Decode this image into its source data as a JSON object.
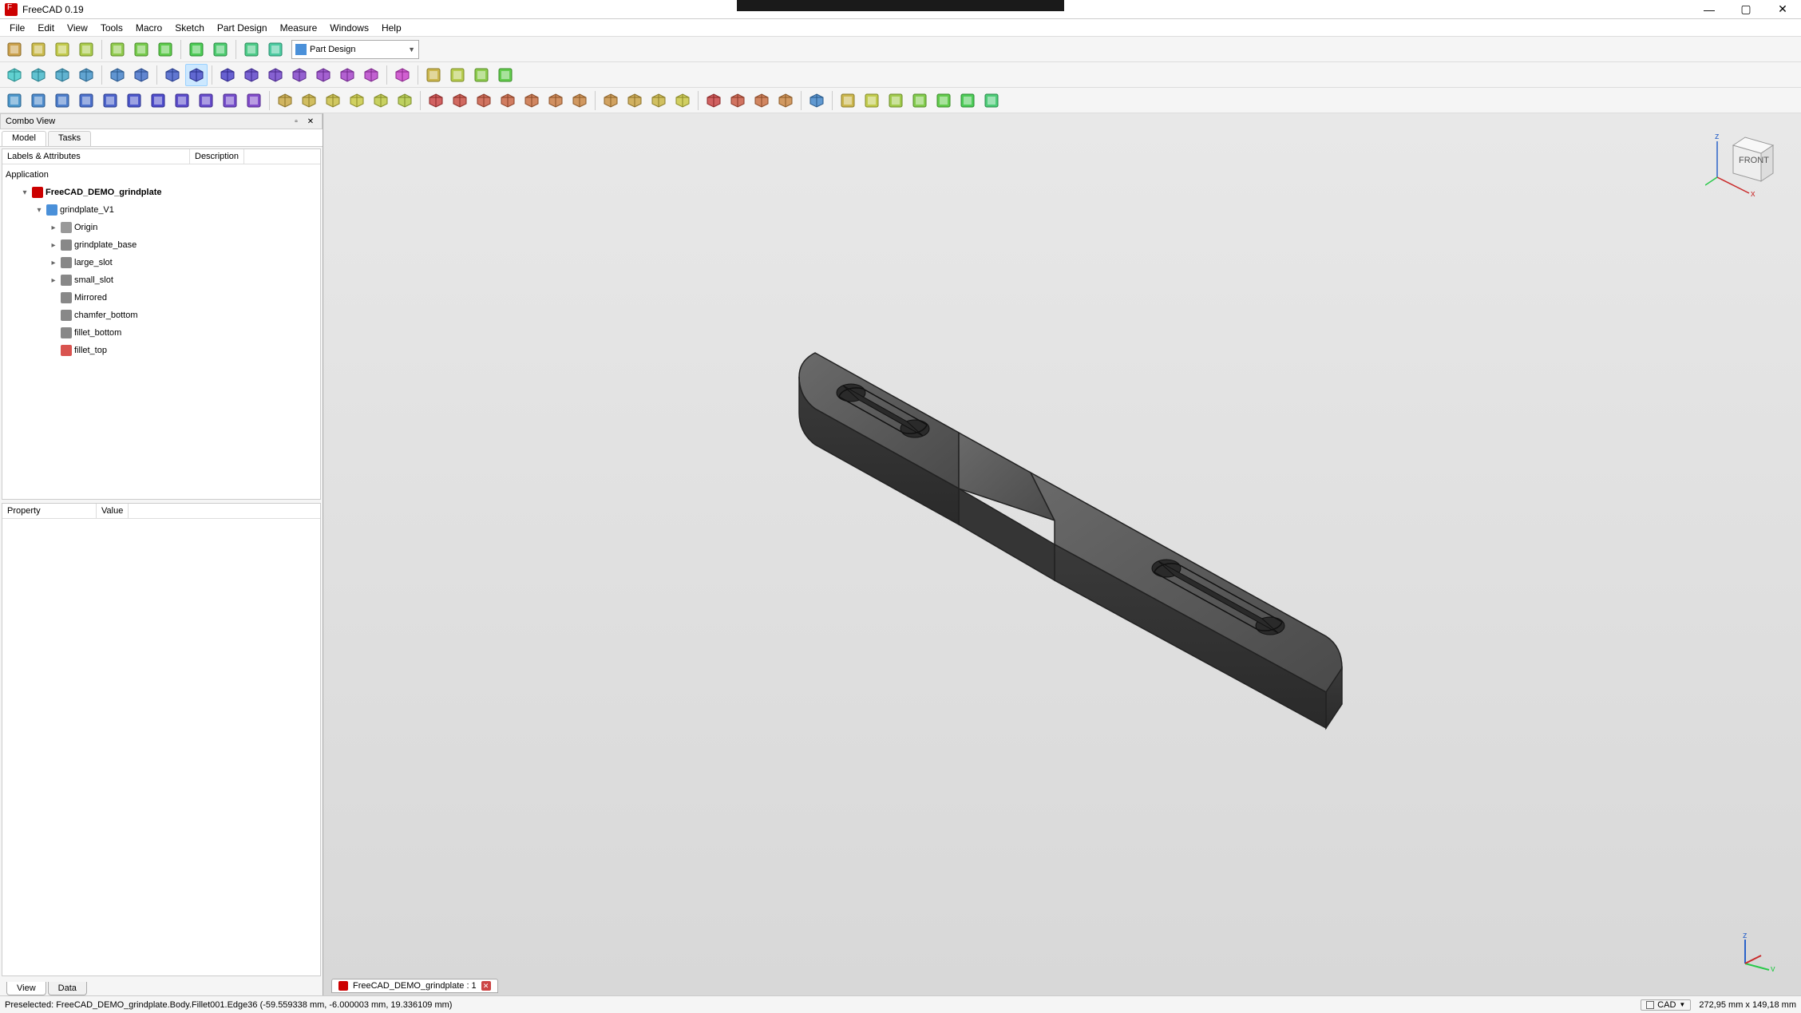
{
  "app": {
    "title": "FreeCAD 0.19"
  },
  "menu": [
    "File",
    "Edit",
    "View",
    "Tools",
    "Macro",
    "Sketch",
    "Part Design",
    "Measure",
    "Windows",
    "Help"
  ],
  "workbench": {
    "selected": "Part Design"
  },
  "combo": {
    "title": "Combo View",
    "tabs": [
      "Model",
      "Tasks"
    ],
    "active_tab": 0,
    "headers": [
      "Labels & Attributes",
      "Description"
    ],
    "application_label": "Application",
    "tree": [
      {
        "depth": 2,
        "exp": "▾",
        "icon": "doc",
        "label": "FreeCAD_DEMO_grindplate",
        "bold": true
      },
      {
        "depth": 3,
        "exp": "▾",
        "icon": "body",
        "label": "grindplate_V1"
      },
      {
        "depth": 4,
        "exp": "▸",
        "icon": "origin",
        "label": "Origin"
      },
      {
        "depth": 4,
        "exp": "▸",
        "icon": "feat",
        "label": "grindplate_base"
      },
      {
        "depth": 4,
        "exp": "▸",
        "icon": "feat",
        "label": "large_slot"
      },
      {
        "depth": 4,
        "exp": "▸",
        "icon": "feat",
        "label": "small_slot"
      },
      {
        "depth": 4,
        "exp": "",
        "icon": "feat",
        "label": "Mirrored"
      },
      {
        "depth": 4,
        "exp": "",
        "icon": "feat",
        "label": "chamfer_bottom"
      },
      {
        "depth": 4,
        "exp": "",
        "icon": "feat",
        "label": "fillet_bottom"
      },
      {
        "depth": 4,
        "exp": "",
        "icon": "fillet",
        "label": "fillet_top"
      }
    ],
    "prop_headers": [
      "Property",
      "Value"
    ],
    "bottom_tabs": [
      "View",
      "Data"
    ],
    "bottom_active": 0
  },
  "doc_tab": {
    "label": "FreeCAD_DEMO_grindplate : 1"
  },
  "status": {
    "left": "Preselected: FreeCAD_DEMO_grindplate.Body.Fillet001.Edge36 (-59.559338 mm, -6.000003 mm, 19.336109 mm)",
    "cad": "CAD",
    "dims": "272,95 mm x 149,18 mm"
  },
  "toolbar1_icons": [
    "new",
    "open",
    "save",
    "print",
    "cut",
    "copy",
    "paste",
    "undo",
    "redo",
    "refresh",
    "whatsthis"
  ],
  "toolbar2_icons": [
    "fit-all",
    "fit-sel",
    "draw-style",
    "bbox",
    "nav-back",
    "nav-fwd",
    "link-goto",
    "zoom-sel",
    "iso",
    "front",
    "top",
    "right",
    "rear",
    "bottom",
    "left",
    "measure"
  ],
  "toolbar2b_icons": [
    "group-new",
    "group-link",
    "export",
    "import"
  ],
  "toolbar3a_icons": [
    "body",
    "sketch",
    "edit-sketch",
    "map-sketch",
    "datum-point",
    "datum-line",
    "datum-plane",
    "datum-cs",
    "shape-binder",
    "sub-binder",
    "clone"
  ],
  "toolbar3b_icons": [
    "pad",
    "revolution",
    "loft",
    "pipe",
    "helix",
    "primitive-add"
  ],
  "toolbar3c_icons": [
    "pocket",
    "hole",
    "groove",
    "sub-loft",
    "sub-pipe",
    "sub-helix",
    "primitive-sub"
  ],
  "toolbar3d_icons": [
    "mirror",
    "linear",
    "polar",
    "multi"
  ],
  "toolbar3e_icons": [
    "fillet",
    "chamfer",
    "draft",
    "thickness"
  ],
  "toolbar3f_icons": [
    "boolean"
  ],
  "toolbar3g_icons": [
    "meas-lin",
    "meas-ang",
    "meas-refresh",
    "meas-clear",
    "meas-toggle",
    "meas-toggle3d",
    "meas-toggledelta"
  ]
}
